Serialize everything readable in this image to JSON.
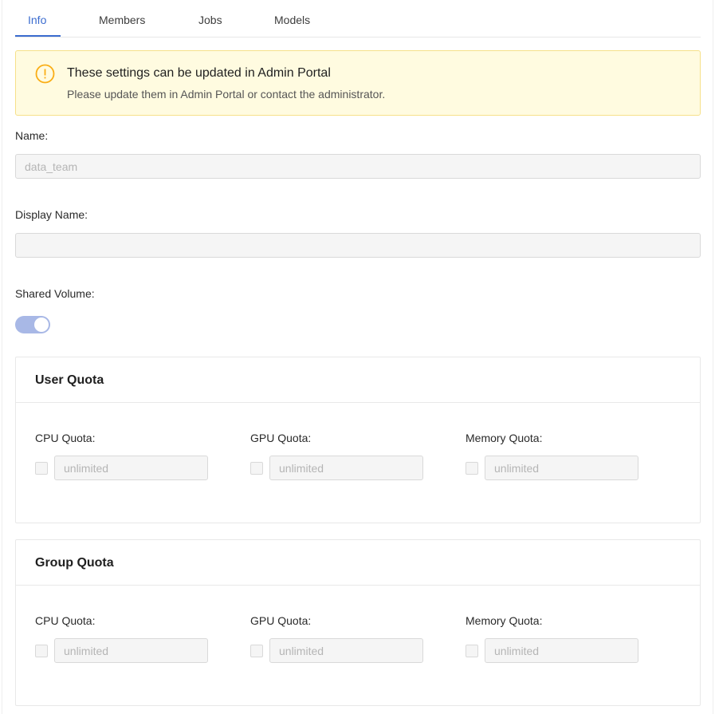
{
  "tabs": [
    {
      "label": "Info",
      "active": true
    },
    {
      "label": "Members",
      "active": false
    },
    {
      "label": "Jobs",
      "active": false
    },
    {
      "label": "Models",
      "active": false
    }
  ],
  "alert": {
    "icon": "exclamation-circle-icon",
    "title": "These settings can be updated in Admin Portal",
    "description": "Please update them in Admin Portal or contact the administrator.",
    "color": "#faad14"
  },
  "form": {
    "name_label": "Name",
    "name_value": "data_team",
    "display_name_label": "Display Name",
    "display_name_value": "",
    "shared_volume_label": "Shared Volume",
    "shared_volume_on": true
  },
  "user_quota": {
    "title": "User Quota",
    "cpu_label": "CPU Quota",
    "cpu_placeholder": "unlimited",
    "gpu_label": "GPU Quota",
    "gpu_placeholder": "unlimited",
    "memory_label": "Memory Quota",
    "memory_placeholder": "unlimited"
  },
  "group_quota": {
    "title": "Group Quota",
    "cpu_label": "CPU Quota",
    "cpu_placeholder": "unlimited",
    "gpu_label": "GPU Quota",
    "gpu_placeholder": "unlimited",
    "memory_label": "Memory Quota",
    "memory_placeholder": "unlimited"
  },
  "colors": {
    "accent": "#3b6ccf",
    "warning": "#faad14",
    "toggle": "#a8b8e6"
  }
}
